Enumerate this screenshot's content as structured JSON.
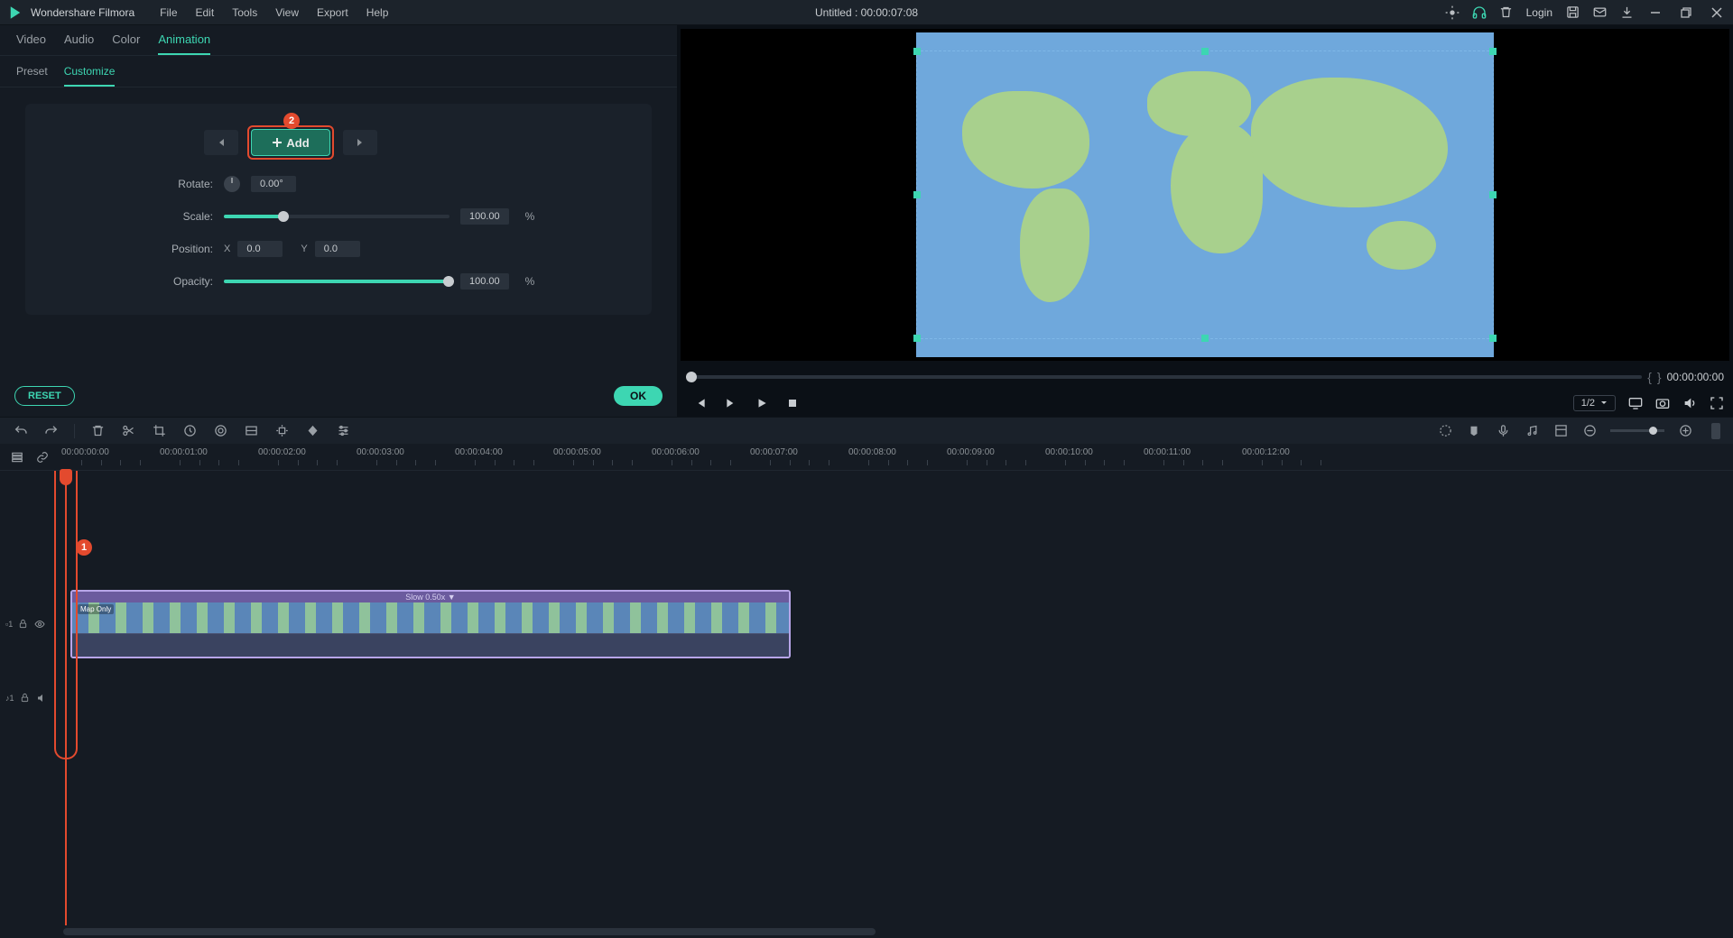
{
  "titlebar": {
    "brand": "Wondershare Filmora",
    "menu": [
      "File",
      "Edit",
      "Tools",
      "View",
      "Export",
      "Help"
    ],
    "docTitle": "Untitled : 00:00:07:08",
    "login": "Login"
  },
  "tabs1": [
    "Video",
    "Audio",
    "Color",
    "Animation"
  ],
  "tabs1_active": 3,
  "tabs2": [
    "Preset",
    "Customize"
  ],
  "tabs2_active": 1,
  "badges": {
    "add": "2",
    "playhead": "1"
  },
  "anim": {
    "addLabel": "Add",
    "rotate": {
      "label": "Rotate:",
      "value": "0.00°"
    },
    "scale": {
      "label": "Scale:",
      "value": "100.00",
      "unit": "%",
      "fillPct": 26
    },
    "position": {
      "label": "Position:",
      "x": "0.0",
      "y": "0.0"
    },
    "opacity": {
      "label": "Opacity:",
      "value": "100.00",
      "unit": "%",
      "fillPct": 100
    }
  },
  "footer": {
    "reset": "RESET",
    "ok": "OK"
  },
  "player": {
    "timecode": "00:00:00:00",
    "ratio": "1/2"
  },
  "ruler": {
    "labels": [
      "00:00:00:00",
      "00:00:01:00",
      "00:00:02:00",
      "00:00:03:00",
      "00:00:04:00",
      "00:00:05:00",
      "00:00:06:00",
      "00:00:07:00",
      "00:00:08:00",
      "00:00:09:00",
      "00:00:10:00",
      "00:00:11:00",
      "00:00:12:00"
    ]
  },
  "clip": {
    "speedLabel": "Slow 0.50x ▼",
    "name": "Map Only"
  },
  "trackLabels": {
    "video": "1",
    "audio": "1"
  }
}
